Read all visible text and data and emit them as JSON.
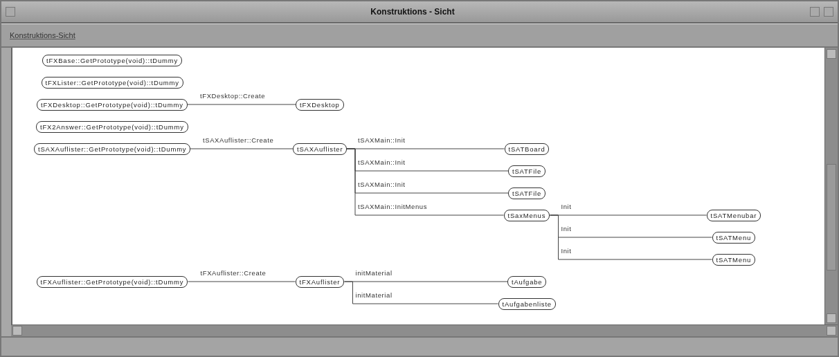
{
  "window": {
    "title": "Konstruktions - Sicht"
  },
  "view_tab": {
    "label": "Konstruktions-Sicht"
  },
  "diagram": {
    "nodes": [
      {
        "label": "tFXBase::GetPrototype(void)::tDummy"
      },
      {
        "label": "tFXLister::GetPrototype(void)::tDummy"
      },
      {
        "label": "tFXDesktop::GetPrototype(void)::tDummy",
        "children": [
          {
            "edge": "tFXDesktop::Create",
            "label": "tFXDesktop"
          }
        ]
      },
      {
        "label": "tFX2Answer::GetPrototype(void)::tDummy"
      },
      {
        "label": "tSAXAuflister::GetPrototype(void)::tDummy",
        "children": [
          {
            "edge": "tSAXAuflister::Create",
            "label": "tSAXAuflister",
            "children": [
              {
                "edge": "tSAXMain::Init",
                "label": "tSATBoard"
              },
              {
                "edge": "tSAXMain::Init",
                "label": "tSATFile"
              },
              {
                "edge": "tSAXMain::Init",
                "label": "tSATFile"
              },
              {
                "edge": "tSAXMain::InitMenus",
                "label": "tSaxMenus",
                "children": [
                  {
                    "edge": "Init",
                    "label": "tSATMenubar"
                  },
                  {
                    "edge": "Init",
                    "label": "tSATMenu"
                  },
                  {
                    "edge": "Init",
                    "label": "tSATMenu"
                  }
                ]
              }
            ]
          }
        ]
      },
      {
        "label": "tFXAuflister::GetPrototype(void)::tDummy",
        "children": [
          {
            "edge": "tFXAuflister::Create",
            "label": "tFXAuflister",
            "children": [
              {
                "edge": "initMaterial",
                "label": "tAufgabe"
              },
              {
                "edge": "initMaterial",
                "label": "tAufgabenliste"
              }
            ]
          }
        ]
      }
    ]
  }
}
